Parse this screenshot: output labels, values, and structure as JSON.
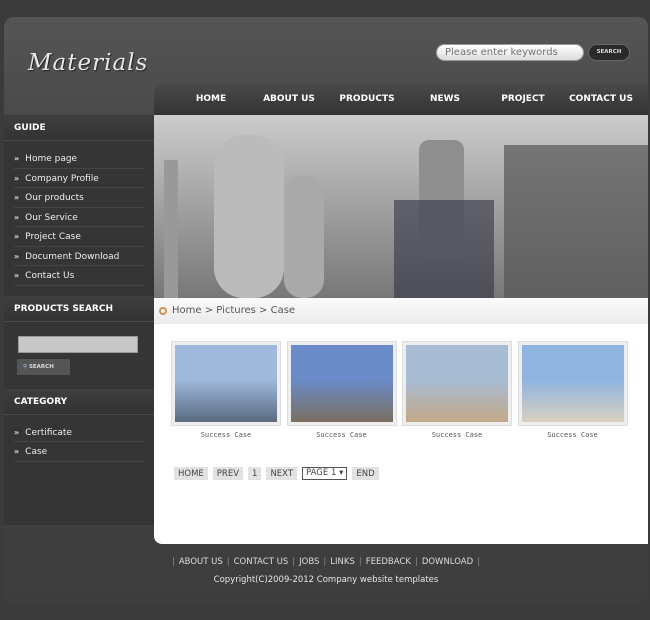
{
  "header": {
    "logo": "Materials",
    "search_placeholder": "Please enter keywords",
    "search_button": "SEARCH"
  },
  "nav": [
    "HOME",
    "ABOUT US",
    "PRODUCTS",
    "NEWS",
    "PROJECT",
    "CONTACT US"
  ],
  "sidebar": {
    "guide_title": "GUIDE",
    "guide": [
      "Home page",
      "Company Profile",
      "Our products",
      "Our Service",
      "Project Case",
      "Document Download",
      "Contact Us"
    ],
    "search_title": "PRODUCTS SEARCH",
    "search_button": "SEARCH",
    "category_title": "CATEGORY",
    "category": [
      "Certificate",
      "Case"
    ]
  },
  "breadcrumb": "Home > Pictures > Case",
  "thumbs": [
    {
      "caption": "Success Case",
      "colors": [
        "#9fb8dc",
        "#5a6a80"
      ]
    },
    {
      "caption": "Success Case",
      "colors": [
        "#6a8ac8",
        "#7a6f60"
      ]
    },
    {
      "caption": "Success Case",
      "colors": [
        "#a8bcd4",
        "#c2a888"
      ]
    },
    {
      "caption": "Success Case",
      "colors": [
        "#8fb4e0",
        "#d8d0c0"
      ]
    }
  ],
  "pager": {
    "home": "HOME",
    "prev": "PREV",
    "page": "1",
    "next": "NEXT",
    "select": "PAGE 1",
    "end": "END"
  },
  "footer": {
    "links": [
      "ABOUT US",
      "CONTACT US",
      "JOBS",
      "LINKS",
      "FEEDBACK",
      "DOWNLOAD"
    ],
    "copyright": "Copyright(C)2009-2012  Company website templates"
  }
}
